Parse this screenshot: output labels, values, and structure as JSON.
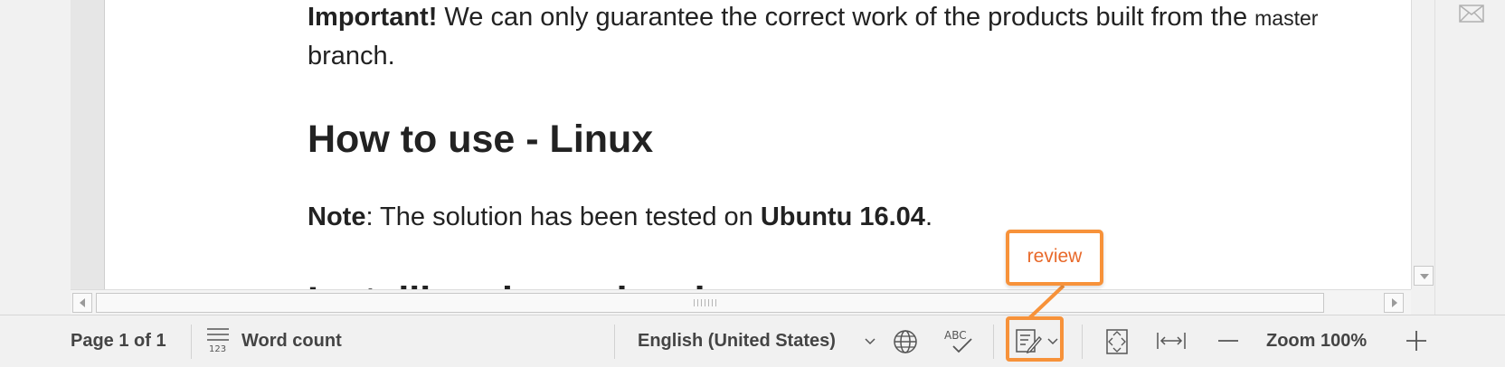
{
  "document": {
    "p1_bold": "Important!",
    "p1_text1": " We can only guarantee the correct work of the products built from the ",
    "p1_code": "master",
    "p1_text2": " branch.",
    "heading": "How to use - Linux",
    "p2_bold1": "Note",
    "p2_text": ": The solution has been tested on ",
    "p2_bold2": "Ubuntu 16.04",
    "p2_end": ".",
    "next_heading_partial": "Installing dependencies"
  },
  "statusbar": {
    "page": "Page 1 of 1",
    "word_count": "Word count",
    "language": "English (United States)",
    "zoom": "Zoom 100%"
  },
  "icons": {
    "word_count": "word-count-icon",
    "language": "globe-icon",
    "spellcheck": "spellcheck-icon",
    "review": "track-changes-icon",
    "fit_page": "fit-page-icon",
    "fit_width": "fit-width-icon",
    "zoom_out": "minus-icon",
    "zoom_in": "plus-icon",
    "mail": "envelope-icon"
  },
  "annotation": {
    "label": "review",
    "color": "#f7923a"
  }
}
